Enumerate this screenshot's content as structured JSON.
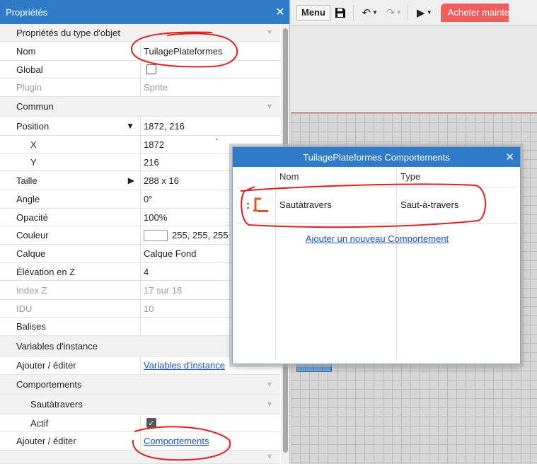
{
  "props": {
    "title": "Propriétés",
    "close": "✕",
    "section_object_type": "Propriétés du type d'objet",
    "name_label": "Nom",
    "name_value": "TuilagePlateformes",
    "global_label": "Global",
    "plugin_label": "Plugin",
    "plugin_value": "Sprite",
    "section_common": "Commun",
    "position_label": "Position",
    "position_value": "1872, 216",
    "x_label": "X",
    "x_value": "1872",
    "y_label": "Y",
    "y_value": "216",
    "size_label": "Taille",
    "size_value": "288 x 16",
    "angle_label": "Angle",
    "angle_value": "0°",
    "opacity_label": "Opacité",
    "opacity_value": "100%",
    "color_label": "Couleur",
    "color_value": "255, 255, 255",
    "layer_label": "Calque",
    "layer_value": "Calque Fond",
    "z_elev_label": "Élévation en Z",
    "z_elev_value": "4",
    "z_index_label": "Index Z",
    "z_index_value": "17 sur 18",
    "uid_label": "IDU",
    "uid_value": "10",
    "tags_label": "Balises",
    "section_instance_vars": "Variables d'instance",
    "add_edit_label": "Ajouter / éditer",
    "instance_vars_link": "Variables d'instance",
    "section_behaviors": "Comportements",
    "behavior_sub": "Sautàtravers",
    "active_label": "Actif",
    "add_edit_label_2": "Ajouter / éditer",
    "behaviors_link": "Comportements"
  },
  "toolbar": {
    "menu": "Menu",
    "buy": "Acheter maintenant"
  },
  "dialog": {
    "title": "TuilagePlateformes Comportements",
    "close": "✕",
    "col_name": "Nom",
    "col_type": "Type",
    "behavior_name": "Sautàtravers",
    "behavior_type": "Saut-à-travers",
    "add_link": "Ajouter un nouveau Comportement"
  },
  "colors": {
    "header_blue": "#2f7bc8",
    "buy_red": "#ef5d5d",
    "behavior_icon": "#d9591e",
    "annotation_red": "#e02020"
  }
}
